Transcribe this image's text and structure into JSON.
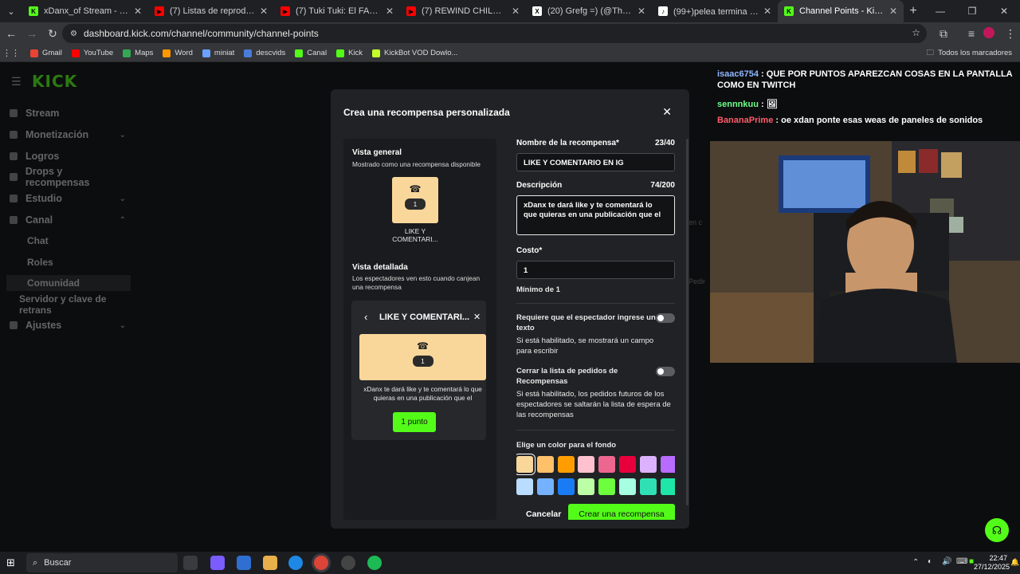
{
  "browser": {
    "tabs": [
      {
        "title": "xDanx_of Stream - Watch Live o",
        "favicon": "kick-icon",
        "color": "#53fc18",
        "letter": "K"
      },
      {
        "title": "(7) Listas de reproducción - You",
        "favicon": "youtube-icon",
        "color": "#ff0000",
        "letter": "▶"
      },
      {
        "title": "(7) Tuki Tuki: El FAMOSO PAYAS",
        "favicon": "youtube-icon",
        "color": "#ff0000",
        "letter": "▶"
      },
      {
        "title": "(7) REWIND CHILE 2025 - YouT",
        "favicon": "youtube-icon",
        "color": "#ff0000",
        "letter": "▶"
      },
      {
        "title": "(20) Grefg =) (@TheGrefg) / X",
        "favicon": "x-icon",
        "color": "#ffffff",
        "letter": "X"
      },
      {
        "title": "(99+)pelea termina mal😂😂",
        "favicon": "tiktok-icon",
        "color": "#ffffff",
        "letter": "♪"
      },
      {
        "title": "Channel Points - Kick Dashboa",
        "favicon": "kick-icon",
        "color": "#53fc18",
        "letter": "K",
        "active": true
      }
    ],
    "url": "dashboard.kick.com/channel/community/channel-points",
    "bookmarks": [
      {
        "label": "Gmail",
        "color": "#ea4335"
      },
      {
        "label": "YouTube",
        "color": "#ff0000"
      },
      {
        "label": "Maps",
        "color": "#34a853"
      },
      {
        "label": "Word",
        "color": "#ff9800"
      },
      {
        "label": "miniat",
        "color": "#6aa0ff"
      },
      {
        "label": "descvids",
        "color": "#4a7bd8"
      },
      {
        "label": "Canal",
        "color": "#53fc18"
      },
      {
        "label": "Kick",
        "color": "#53fc18"
      },
      {
        "label": "KickBot VOD Dowlo...",
        "color": "#c4ff2a"
      }
    ],
    "all_bookmarks": "Todos los marcadores"
  },
  "sidebar": {
    "logo": "KICK",
    "items": [
      {
        "label": "Stream",
        "chevron": ""
      },
      {
        "label": "Monetización",
        "chevron": "⌄"
      },
      {
        "label": "Logros",
        "chevron": ""
      },
      {
        "label": "Drops y recompensas",
        "chevron": ""
      },
      {
        "label": "Estudio",
        "chevron": "⌄"
      },
      {
        "label": "Canal",
        "chevron": "⌃"
      }
    ],
    "sub_items": [
      "Chat",
      "Roles",
      "Comunidad"
    ],
    "extra": "Servidor y clave de retrans",
    "settings": "Ajustes"
  },
  "modal": {
    "title": "Crea una recompensa personalizada",
    "overview_title": "Vista general",
    "overview_sub": "Mostrado como una recompensa disponible",
    "card_cost": "1",
    "card_label_1": "LIKE Y",
    "card_label_2": "COMENTARI...",
    "detail_title": "Vista detallada",
    "detail_sub": "Los espectadores ven esto cuando canjean una recompensa",
    "detail_header": "LIKE Y COMENTARI...",
    "detail_desc": "xDanx te dará like y te comentará lo que quieras en una publicación que el",
    "detail_button": "1 punto",
    "name_label": "Nombre de la recompensa*",
    "name_count": "23/40",
    "name_value": "LIKE Y COMENTARIO EN IG",
    "desc_label": "Descripción",
    "desc_count": "74/200",
    "desc_value": "xDanx te dará like y te comentará lo que quieras en una publicación que el",
    "cost_label": "Costo*",
    "cost_value": "1",
    "cost_min": "Mínimo de 1",
    "req_text_label": "Requiere que el espectador ingrese un texto",
    "req_text_help": "Si está habilitado, se mostrará un campo para escribir",
    "close_list_label": "Cerrar la lista de pedidos de Recompensas",
    "close_list_help": "Si está habilitado, los pedidos futuros de los espectadores se saltarán la lista de espera de las recompensas",
    "color_label": "Elige un color para el fondo",
    "colors": [
      "#f9d79b",
      "#ffc06a",
      "#ff9d00",
      "#ffc1cf",
      "#ed6690",
      "#e8003c",
      "#dcb2ff",
      "#b76bff",
      "#b9dcff",
      "#74b2ff",
      "#1a7cf5",
      "#bdffa6",
      "#6dff3e",
      "#a6ffe1",
      "#2fe0b5",
      "#1ee5a8"
    ],
    "cancel": "Cancelar",
    "create": "Crear una recompensa"
  },
  "chat": [
    {
      "user": "isaac6754",
      "user_color": "#8fb6ff",
      "text": "QUE POR PUNTOS APAREZCAN COSAS EN LA PANTALLA COMO EN TWITCH"
    },
    {
      "user": "sennnkuu",
      "user_color": "#6dff8a",
      "text": "🖼"
    },
    {
      "user": "BananaPrime",
      "user_color": "#ff5c6a",
      "text": "oe xdan ponte esas weas de paneles de sonidos"
    }
  ],
  "taskbar": {
    "search": "Buscar",
    "time": "22:47",
    "date": "27/12/2025"
  }
}
